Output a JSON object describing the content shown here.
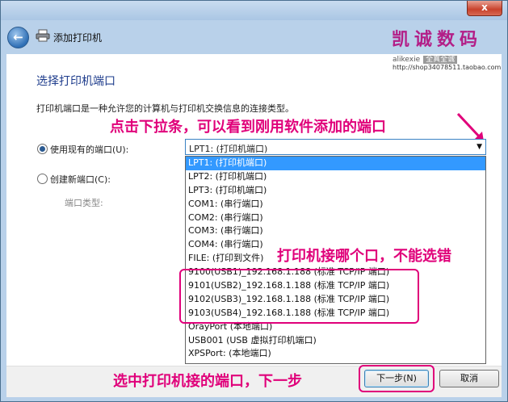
{
  "window": {
    "title": "添加打印机",
    "close_label": "x"
  },
  "watermark": {
    "brand": "凯诚数码",
    "sub_name": "alikexie",
    "sub_tag": "全真全诚",
    "url": "http://shop34078511.taobao.com"
  },
  "page": {
    "heading": "选择打印机端口",
    "description": "打印机端口是一种允许您的计算机与打印机交换信息的连接类型。"
  },
  "options": {
    "use_existing_label": "使用现有的端口(U):",
    "create_new_label": "创建新端口(C):",
    "port_type_label": "端口类型:",
    "selected_value": "LPT1: (打印机端口)"
  },
  "dropdown_items": [
    "LPT1: (打印机端口)",
    "LPT2: (打印机端口)",
    "LPT3: (打印机端口)",
    "COM1: (串行端口)",
    "COM2: (串行端口)",
    "COM3: (串行端口)",
    "COM4: (串行端口)",
    "FILE: (打印到文件)",
    "9100(USB1)_192.168.1.188 (标准 TCP/IP 端口)",
    "9101(USB2)_192.168.1.188 (标准 TCP/IP 端口)",
    "9102(USB3)_192.168.1.188 (标准 TCP/IP 端口)",
    "9103(USB4)_192.168.1.188 (标准 TCP/IP 端口)",
    "OrayPort (本地端口)",
    "USB001 (USB 虚拟打印机端口)",
    "XPSPort: (本地端口)"
  ],
  "annotations": {
    "dropdown_hint": "点击下拉条，可以看到刚用软件添加的端口",
    "port_hint": "打印机接哪个口，不能选错",
    "next_hint": "选中打印机接的端口，下一步"
  },
  "buttons": {
    "next": "下一步(N)",
    "cancel": "取消"
  },
  "colors": {
    "annotation": "#e0007a",
    "selection": "#3399ff",
    "heading": "#1e3c8c"
  }
}
